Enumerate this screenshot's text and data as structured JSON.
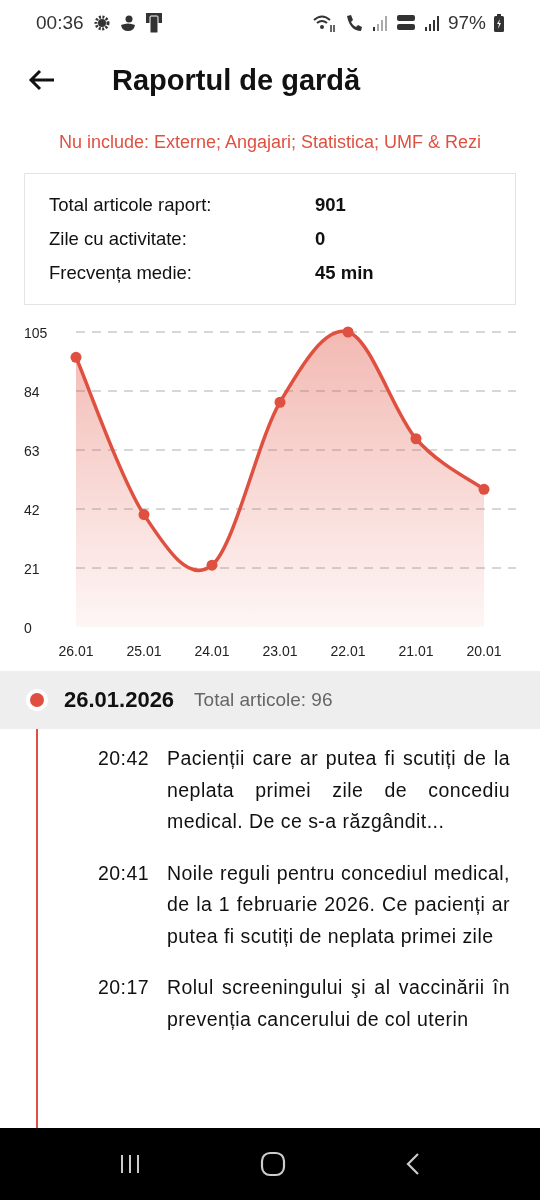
{
  "status_bar": {
    "time": "00:36",
    "battery": "97%"
  },
  "header": {
    "title": "Raportul de gardă"
  },
  "notice": "Nu include: Externe; Angajari; Statistica; UMF & Rezi",
  "summary": [
    {
      "label": "Total articole raport:",
      "value": "901"
    },
    {
      "label": "Zile cu activitate:",
      "value": "0"
    },
    {
      "label": "Frecvența medie:",
      "value": "45 min"
    }
  ],
  "chart_data": {
    "type": "area",
    "categories": [
      "26.01",
      "25.01",
      "24.01",
      "23.01",
      "22.01",
      "21.01",
      "20.01"
    ],
    "grid": true,
    "series": [
      {
        "color": "#e05040",
        "values": [
          96,
          40,
          22,
          80,
          105,
          67,
          49
        ]
      }
    ],
    "ylim": [
      0,
      105
    ],
    "yticks": [
      0,
      21,
      42,
      63,
      84,
      105
    ]
  },
  "day": {
    "date": "26.01.2026",
    "total": "Total articole: 96",
    "items": [
      {
        "time": "20:42",
        "text": "Pacienții care ar putea fi scutiți de la neplata primei zile de concediu medical. De ce s-a răzgândit..."
      },
      {
        "time": "20:41",
        "text": "Noile reguli pentru concediul medical, de la 1 februarie 2026. Ce pacienți ar putea fi scutiți de neplata primei zile"
      },
      {
        "time": "20:17",
        "text": "Rolul screeningului şi al vaccinării în prevenția cancerului de col uterin"
      }
    ]
  }
}
